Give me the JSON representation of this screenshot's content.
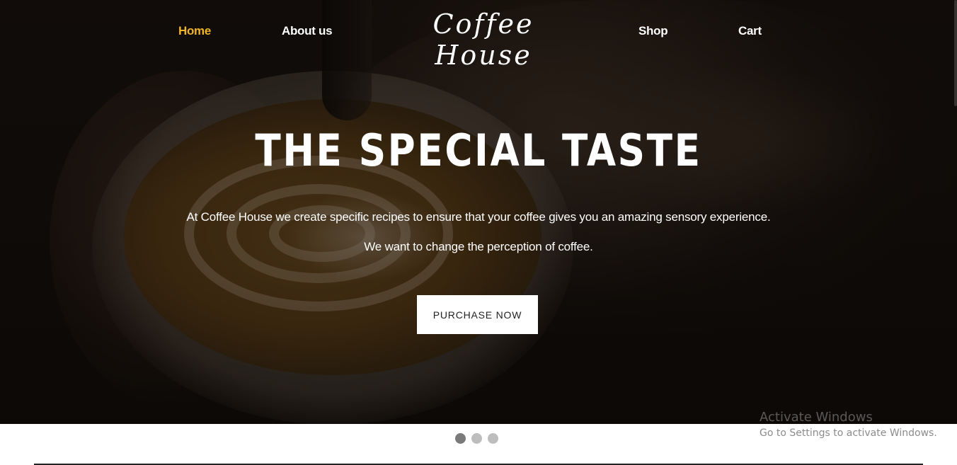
{
  "nav": {
    "items": [
      {
        "label": "Home",
        "active": true
      },
      {
        "label": "About us",
        "active": false
      },
      {
        "label": "Shop",
        "active": false
      },
      {
        "label": "Cart",
        "active": false
      }
    ],
    "logo": "Coffee House",
    "active_color": "#f0b429"
  },
  "hero": {
    "headline": "THE SPECIAL TASTE",
    "line1": "At Coffee House we create specific recipes to ensure that your coffee gives you an amazing sensory experience.",
    "line2": "We want to change the perception of coffee.",
    "cta_label": "PURCHASE NOW",
    "background_image": "latte-art-pour-icon"
  },
  "carousel": {
    "slide_count": 3,
    "active_index": 0
  },
  "os_watermark": {
    "title": "Activate Windows",
    "subtitle": "Go to Settings to activate Windows."
  }
}
